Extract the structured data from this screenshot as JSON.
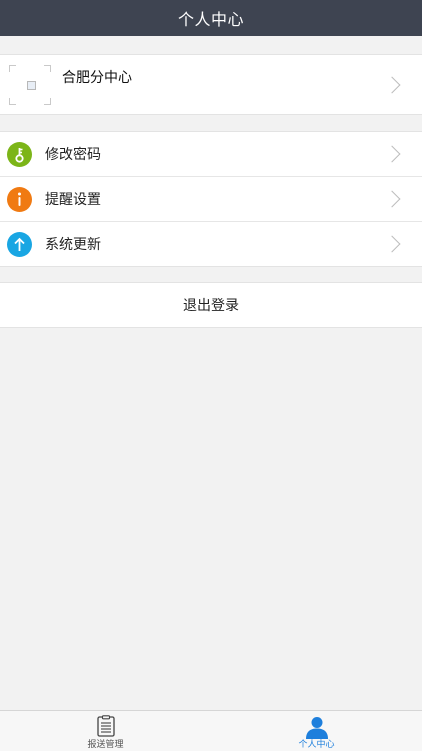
{
  "header": {
    "title": "个人中心"
  },
  "profile": {
    "name": "合肥分中心"
  },
  "menu": {
    "items": [
      {
        "label": "修改密码",
        "icon": "key-icon",
        "color": "#7cb518"
      },
      {
        "label": "提醒设置",
        "icon": "info-icon",
        "color": "#f07a12"
      },
      {
        "label": "系统更新",
        "icon": "arrow-up-icon",
        "color": "#19a6e3"
      }
    ]
  },
  "logout": {
    "label": "退出登录"
  },
  "tabbar": {
    "tabs": [
      {
        "label": "报送管理",
        "icon": "clipboard-icon",
        "active": false
      },
      {
        "label": "个人中心",
        "icon": "person-icon",
        "active": true
      }
    ],
    "active_color": "#1e7fdc"
  }
}
